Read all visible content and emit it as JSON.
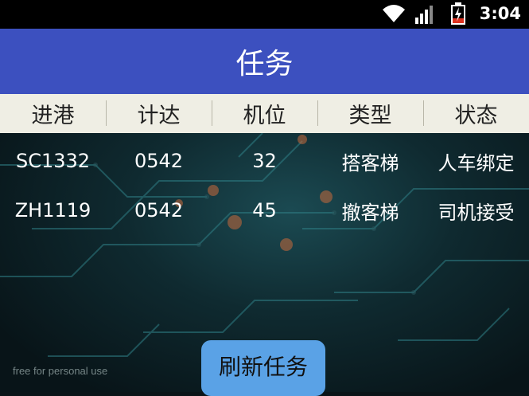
{
  "status_bar": {
    "time": "3:04"
  },
  "title": "任务",
  "table": {
    "headers": [
      "进港",
      "计达",
      "机位",
      "类型",
      "状态"
    ],
    "rows": [
      [
        "SC1332",
        "0542",
        "32",
        "搭客梯",
        "人车绑定"
      ],
      [
        "ZH1119",
        "0542",
        "45",
        "撤客梯",
        "司机接受"
      ]
    ]
  },
  "watermark": "free for personal use",
  "refresh_button_label": "刷新任务"
}
